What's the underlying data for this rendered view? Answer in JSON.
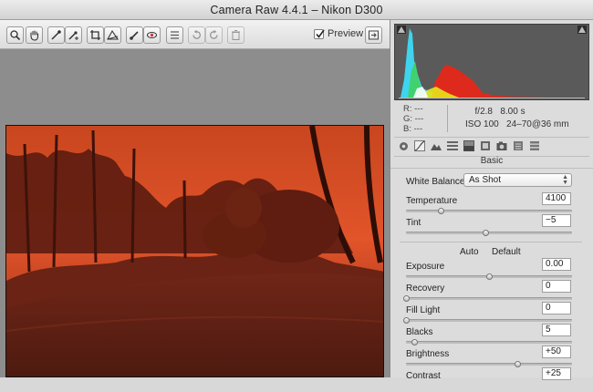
{
  "window": {
    "title": "Camera Raw 4.4.1  –  Nikon D300"
  },
  "toolbar": {
    "tools": [
      {
        "name": "zoom-tool",
        "icon": "magnifier-icon"
      },
      {
        "name": "hand-tool",
        "icon": "hand-icon"
      },
      {
        "name": "white-balance-tool",
        "icon": "eyedropper-icon"
      },
      {
        "name": "color-sampler-tool",
        "icon": "eyedropper-plus-icon"
      },
      {
        "name": "crop-tool",
        "icon": "crop-icon"
      },
      {
        "name": "straighten-tool",
        "icon": "straighten-icon"
      },
      {
        "name": "retouch-tool",
        "icon": "brush-icon"
      },
      {
        "name": "red-eye-tool",
        "icon": "red-eye-icon"
      },
      {
        "name": "preferences-button",
        "icon": "list-icon"
      },
      {
        "name": "rotate-left-button",
        "icon": "rotate-ccw-icon"
      },
      {
        "name": "rotate-right-button",
        "icon": "rotate-cw-icon"
      },
      {
        "name": "delete-button",
        "icon": "trash-icon"
      }
    ],
    "preview_label": "Preview",
    "preview_checked": true,
    "fullscreen_icon": "fullscreen-icon"
  },
  "info": {
    "r_label": "R:",
    "g_label": "G:",
    "b_label": "B:",
    "r_value": "---",
    "g_value": "---",
    "b_value": "---",
    "aperture": "f/2.8",
    "shutter": "8.00 s",
    "iso": "ISO 100",
    "lens": "24–70@36 mm"
  },
  "tabs": [
    "basic-tab",
    "tone-curve-tab",
    "detail-tab",
    "hsl-tab",
    "split-toning-tab",
    "lens-tab",
    "camera-calibration-tab",
    "presets-tab",
    "snapshots-tab"
  ],
  "panel": {
    "title": "Basic",
    "white_balance_label": "White Balance:",
    "white_balance_value": "As Shot",
    "auto_label": "Auto",
    "default_label": "Default",
    "sliders": [
      {
        "label": "Temperature",
        "value": "4100",
        "position": 0.21
      },
      {
        "label": "Tint",
        "value": "−5",
        "position": 0.48
      },
      {
        "label": "Exposure",
        "value": "0.00",
        "position": 0.5
      },
      {
        "label": "Recovery",
        "value": "0",
        "position": 0.0
      },
      {
        "label": "Fill Light",
        "value": "0",
        "position": 0.0
      },
      {
        "label": "Blacks",
        "value": "5",
        "position": 0.05
      },
      {
        "label": "Brightness",
        "value": "+50",
        "position": 0.67
      },
      {
        "label": "Contrast",
        "value": "+25",
        "position": 0.62
      }
    ]
  },
  "colors": {
    "photo_tint": "#b2321c",
    "canvas": "#8d8d8d",
    "histogram_bg": "#5a5a5a"
  }
}
